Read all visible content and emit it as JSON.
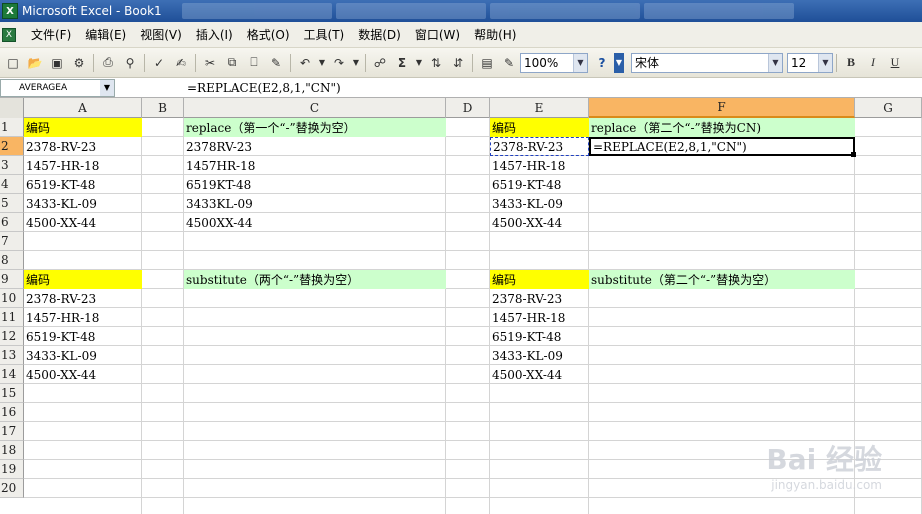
{
  "window": {
    "title": "Microsoft Excel - Book1"
  },
  "menu": [
    "文件(F)",
    "编辑(E)",
    "视图(V)",
    "插入(I)",
    "格式(O)",
    "工具(T)",
    "数据(D)",
    "窗口(W)",
    "帮助(H)"
  ],
  "toolbar": {
    "zoom": "100%",
    "font": "宋体",
    "font_size": "12",
    "bold": "B",
    "italic": "I",
    "underline": "U",
    "sigma": "Σ"
  },
  "namebox": "AVERAGEA",
  "formula": "=REPLACE(E2,8,1,\"CN\")",
  "columns": [
    "A",
    "B",
    "C",
    "D",
    "E",
    "F",
    "G"
  ],
  "rows": [
    "1",
    "2",
    "3",
    "4",
    "5",
    "6",
    "7",
    "8",
    "9",
    "10",
    "11",
    "12",
    "13",
    "14",
    "15",
    "16",
    "17",
    "18",
    "19",
    "20"
  ],
  "cells": {
    "A1": "编码",
    "A2": "2378-RV-23",
    "A3": "1457-HR-18",
    "A4": "6519-KT-48",
    "A5": "3433-KL-09",
    "A6": "4500-XX-44",
    "C1": "replace（第一个“-”替换为空）",
    "C2": "2378RV-23",
    "C3": "1457HR-18",
    "C4": "6519KT-48",
    "C5": "3433KL-09",
    "C6": "4500XX-44",
    "E1": "编码",
    "E2": "2378-RV-23",
    "E3": "1457-HR-18",
    "E4": "6519-KT-48",
    "E5": "3433-KL-09",
    "E6": "4500-XX-44",
    "F1": "replace（第二个“-”替换为CN)",
    "F2": "=REPLACE(E2,8,1,\"CN\")",
    "A9": "编码",
    "A10": "2378-RV-23",
    "A11": "1457-HR-18",
    "A12": "6519-KT-48",
    "A13": "3433-KL-09",
    "A14": "4500-XX-44",
    "C9": "substitute（两个“-”替换为空）",
    "E9": "编码",
    "E10": "2378-RV-23",
    "E11": "1457-HR-18",
    "E12": "6519-KT-48",
    "E13": "3433-KL-09",
    "E14": "4500-XX-44",
    "F9": "substitute（第二个“-”替换为空）"
  },
  "watermark": {
    "main": "Bai 经验",
    "sub": "jingyan.baidu.com"
  }
}
